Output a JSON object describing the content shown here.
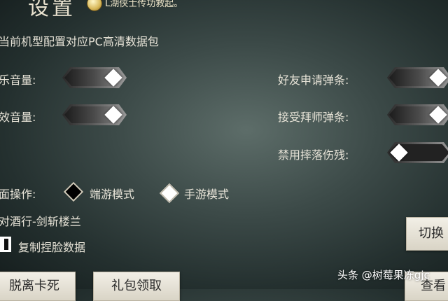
{
  "header": {
    "title": "设置",
    "hint_text": "L湖侠士传功救起。"
  },
  "settings": {
    "pc_hd_pack_label": "当前机型配置对应PC高清数据包",
    "music_volume_label": "乐音量:",
    "sfx_volume_label": "效音量:",
    "friend_request_label": "好友申请弹条:",
    "accept_master_label": "接受拜师弹条:",
    "disable_fall_damage_label": "禁用摔落伤残:",
    "ui_operation_label": "面操作:",
    "client_mode_label": "端游模式",
    "mobile_mode_label": "手游模式",
    "selected_mode": "端游模式",
    "server_name": "对酒行-剑斩楼兰",
    "copy_face_label": "复制捏脸数据",
    "toggles": {
      "music_volume": true,
      "sfx_volume": true,
      "friend_request": true,
      "accept_master": true,
      "disable_fall_damage": false
    }
  },
  "buttons": {
    "switch_label": "切换",
    "unstuck_label": "脱离卡死",
    "gift_label": "礼包领取",
    "view_label": "查看"
  },
  "watermark": {
    "source": "头条",
    "author": "@树莓果冻gjc"
  }
}
